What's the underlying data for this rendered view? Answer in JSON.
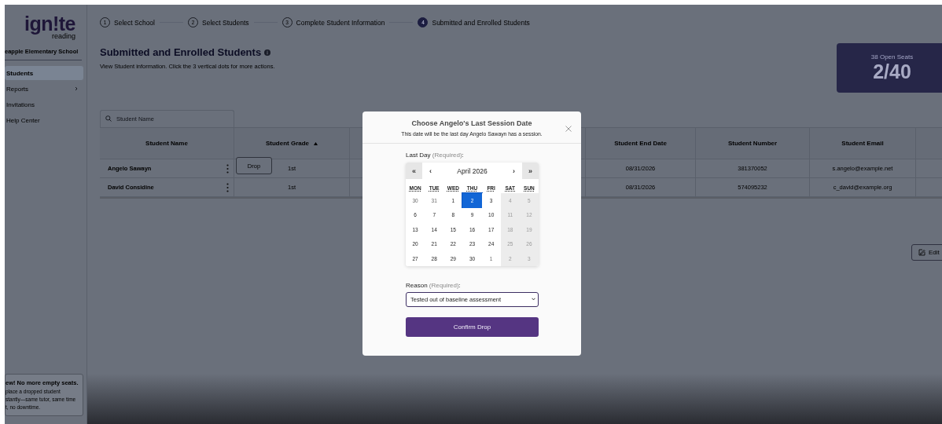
{
  "sidebar": {
    "logo": {
      "word": "ign!te",
      "sub": "reading"
    },
    "school": "eapple Elementary School",
    "items": [
      {
        "label": "Students",
        "selected": true,
        "has_submenu": false
      },
      {
        "label": "Reports",
        "selected": false,
        "has_submenu": true
      },
      {
        "label": "Invitations",
        "selected": false,
        "has_submenu": false
      },
      {
        "label": "Help Center",
        "selected": false,
        "has_submenu": false
      }
    ],
    "promo": {
      "title": "ew! No more empty seats.",
      "lines": [
        "place a dropped student",
        "stantly—same tutor, same time",
        "t, no downtime."
      ]
    }
  },
  "stepper": [
    {
      "number": "1",
      "label": "Select School",
      "selected": false
    },
    {
      "number": "2",
      "label": "Select Students",
      "selected": false
    },
    {
      "number": "3",
      "label": "Complete Student Information",
      "selected": false
    },
    {
      "number": "4",
      "label": "Submitted and Enrolled Students",
      "selected": true
    }
  ],
  "page": {
    "title": "Submitted and Enrolled Students",
    "subtitle": "View Student information. Click the 3 vertical dots for more actions."
  },
  "seats": {
    "caption": "38 Open Seats",
    "count": "2/40"
  },
  "search": {
    "placeholder": "Student Name"
  },
  "table": {
    "columns": [
      {
        "label": "Student Name",
        "sorted": false
      },
      {
        "label": "Student Grade",
        "sorted": true
      },
      {},
      {
        "label": "Student End Date",
        "sorted": false
      },
      {
        "label": "Student Number",
        "sorted": false
      },
      {
        "label": "Student Email",
        "sorted": false
      },
      {
        "sorted": false
      }
    ],
    "rows": [
      {
        "name": "Angelo Sawayn",
        "grade": "1st",
        "end_date": "08/31/2026",
        "number": "381370052",
        "email": "s.angelo@example.net",
        "menu_open": true
      },
      {
        "name": "David Considine",
        "grade": "1st",
        "end_date": "08/31/2026",
        "number": "574095232",
        "email": "c_david@example.org",
        "menu_open": false
      }
    ],
    "row_menu": {
      "label": "Drop"
    }
  },
  "edit_button": {
    "label": "Edit"
  },
  "modal": {
    "title": "Choose Angelo's Last Session Date",
    "subtitle": "This date will be the last day Angelo Sawayn has a session.",
    "date_label": "Last Day",
    "date_hint": "(Required)",
    "date_colon": ":",
    "calendar": {
      "prev_year": "«",
      "prev_month": "‹",
      "month": "April 2026",
      "next_month": "›",
      "next_year": "»",
      "weekdays": [
        "MON",
        "TUE",
        "WED",
        "THU",
        "FRI",
        "SAT",
        "SUN"
      ],
      "weeks": [
        [
          {
            "day": "30",
            "outside": true,
            "disabled": false,
            "selected": false
          },
          {
            "day": "31",
            "outside": true,
            "disabled": false,
            "selected": false
          },
          {
            "day": "1",
            "outside": false,
            "disabled": false,
            "selected": false
          },
          {
            "day": "2",
            "outside": false,
            "disabled": false,
            "selected": true
          },
          {
            "day": "3",
            "outside": false,
            "disabled": false,
            "selected": false
          },
          {
            "day": "4",
            "outside": false,
            "disabled": true,
            "selected": false
          },
          {
            "day": "5",
            "outside": false,
            "disabled": true,
            "selected": false
          }
        ],
        [
          {
            "day": "6",
            "outside": false,
            "disabled": false,
            "selected": false
          },
          {
            "day": "7",
            "outside": false,
            "disabled": false,
            "selected": false
          },
          {
            "day": "8",
            "outside": false,
            "disabled": false,
            "selected": false
          },
          {
            "day": "9",
            "outside": false,
            "disabled": false,
            "selected": false
          },
          {
            "day": "10",
            "outside": false,
            "disabled": false,
            "selected": false
          },
          {
            "day": "11",
            "outside": false,
            "disabled": true,
            "selected": false
          },
          {
            "day": "12",
            "outside": false,
            "disabled": true,
            "selected": false
          }
        ],
        [
          {
            "day": "13",
            "outside": false,
            "disabled": false,
            "selected": false
          },
          {
            "day": "14",
            "outside": false,
            "disabled": false,
            "selected": false
          },
          {
            "day": "15",
            "outside": false,
            "disabled": false,
            "selected": false
          },
          {
            "day": "16",
            "outside": false,
            "disabled": false,
            "selected": false
          },
          {
            "day": "17",
            "outside": false,
            "disabled": false,
            "selected": false
          },
          {
            "day": "18",
            "outside": false,
            "disabled": true,
            "selected": false
          },
          {
            "day": "19",
            "outside": false,
            "disabled": true,
            "selected": false
          }
        ],
        [
          {
            "day": "20",
            "outside": false,
            "disabled": false,
            "selected": false
          },
          {
            "day": "21",
            "outside": false,
            "disabled": false,
            "selected": false
          },
          {
            "day": "22",
            "outside": false,
            "disabled": false,
            "selected": false
          },
          {
            "day": "23",
            "outside": false,
            "disabled": false,
            "selected": false
          },
          {
            "day": "24",
            "outside": false,
            "disabled": false,
            "selected": false
          },
          {
            "day": "25",
            "outside": false,
            "disabled": true,
            "selected": false
          },
          {
            "day": "26",
            "outside": false,
            "disabled": true,
            "selected": false
          }
        ],
        [
          {
            "day": "27",
            "outside": false,
            "disabled": false,
            "selected": false
          },
          {
            "day": "28",
            "outside": false,
            "disabled": false,
            "selected": false
          },
          {
            "day": "29",
            "outside": false,
            "disabled": false,
            "selected": false
          },
          {
            "day": "30",
            "outside": false,
            "disabled": false,
            "selected": false
          },
          {
            "day": "1",
            "outside": true,
            "disabled": false,
            "selected": false
          },
          {
            "day": "2",
            "outside": true,
            "disabled": true,
            "selected": false
          },
          {
            "day": "3",
            "outside": true,
            "disabled": true,
            "selected": false
          }
        ]
      ]
    },
    "reason_label": "Reason",
    "reason_hint": "(Required)",
    "reason_colon": ":",
    "reason_value": "Tested out of baseline assessment",
    "confirm": "Confirm Drop"
  }
}
